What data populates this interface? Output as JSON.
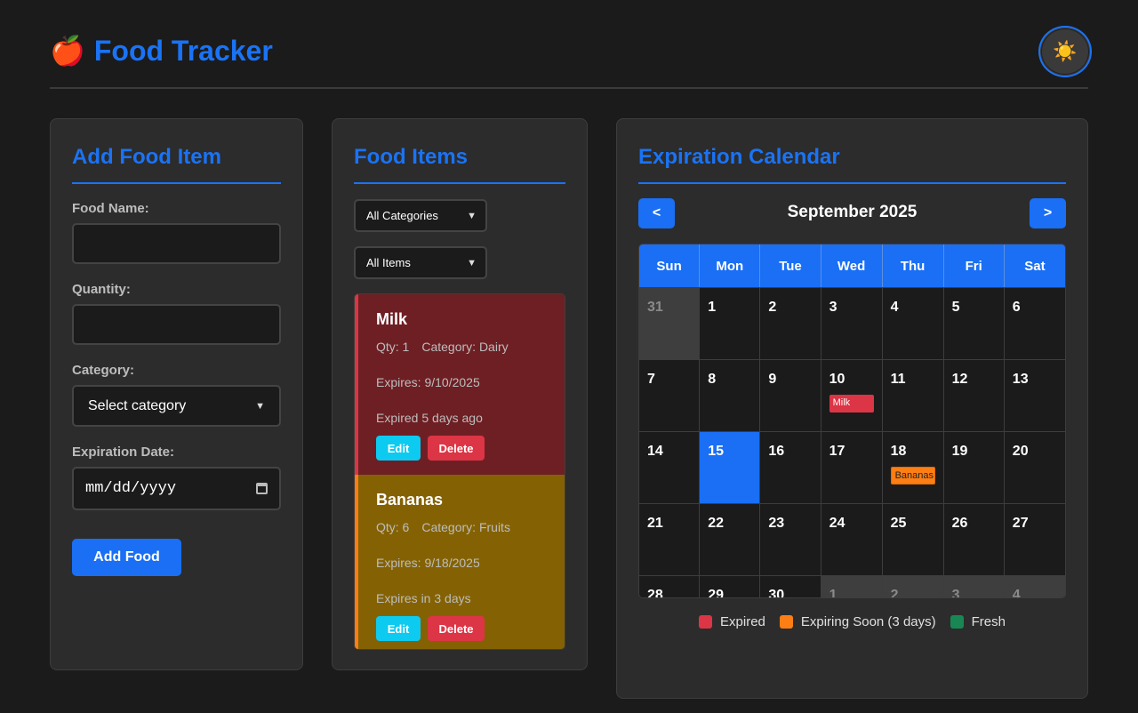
{
  "header": {
    "icon": "🍎",
    "title": "Food Tracker",
    "theme_toggle_icon": "☀️"
  },
  "add_form": {
    "title": "Add Food Item",
    "name_label": "Food Name:",
    "name_value": "",
    "quantity_label": "Quantity:",
    "quantity_value": "",
    "category_label": "Category:",
    "category_selected": "Select category",
    "expiration_label": "Expiration Date:",
    "expiration_placeholder": "mm/dd/yyyy",
    "submit_label": "Add Food"
  },
  "food_items": {
    "title": "Food Items",
    "category_filter": "All Categories",
    "status_filter": "All Items",
    "items": [
      {
        "name": "Milk",
        "qty": "Qty: 1",
        "category": "Category: Dairy",
        "expires": "Expires: 9/10/2025",
        "status": "Expired 5 days ago",
        "edit_label": "Edit",
        "delete_label": "Delete"
      },
      {
        "name": "Bananas",
        "qty": "Qty: 6",
        "category": "Category: Fruits",
        "expires": "Expires: 9/18/2025",
        "status": "Expires in 3 days",
        "edit_label": "Edit",
        "delete_label": "Delete"
      }
    ]
  },
  "calendar": {
    "title": "Expiration Calendar",
    "prev_label": "<",
    "next_label": ">",
    "month": "September 2025",
    "weekdays": [
      "Sun",
      "Mon",
      "Tue",
      "Wed",
      "Thu",
      "Fri",
      "Sat"
    ],
    "days": [
      {
        "n": "31",
        "other": true
      },
      {
        "n": "1"
      },
      {
        "n": "2"
      },
      {
        "n": "3"
      },
      {
        "n": "4"
      },
      {
        "n": "5"
      },
      {
        "n": "6"
      },
      {
        "n": "7"
      },
      {
        "n": "8"
      },
      {
        "n": "9"
      },
      {
        "n": "10",
        "tag": "Milk",
        "tag_type": "expired"
      },
      {
        "n": "11"
      },
      {
        "n": "12"
      },
      {
        "n": "13"
      },
      {
        "n": "14"
      },
      {
        "n": "15",
        "today": true
      },
      {
        "n": "16"
      },
      {
        "n": "17"
      },
      {
        "n": "18",
        "tag": "Bananas",
        "tag_type": "soon"
      },
      {
        "n": "19"
      },
      {
        "n": "20"
      },
      {
        "n": "21"
      },
      {
        "n": "22"
      },
      {
        "n": "23"
      },
      {
        "n": "24"
      },
      {
        "n": "25"
      },
      {
        "n": "26"
      },
      {
        "n": "27"
      },
      {
        "n": "28"
      },
      {
        "n": "29"
      },
      {
        "n": "30"
      },
      {
        "n": "1",
        "other": true
      },
      {
        "n": "2",
        "other": true
      },
      {
        "n": "3",
        "other": true
      },
      {
        "n": "4",
        "other": true
      }
    ],
    "legend": [
      {
        "label": "Expired",
        "color": "#dc3545"
      },
      {
        "label": "Expiring Soon (3 days)",
        "color": "#fd7e14"
      },
      {
        "label": "Fresh",
        "color": "#198754"
      }
    ]
  },
  "colors": {
    "accent": "#1a73f5",
    "expired": "#dc3545",
    "soon": "#fd7e14",
    "fresh": "#198754",
    "edit": "#0dcaf0"
  }
}
